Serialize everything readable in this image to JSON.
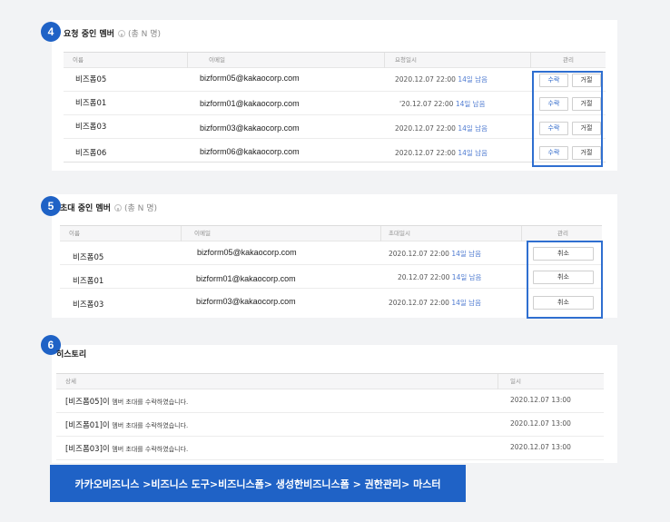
{
  "requested": {
    "badge": "4",
    "title": "요청 중인 멤버",
    "count": "(총 N 명)",
    "headers": {
      "name": "이름",
      "email": "이메일",
      "requested_at": "요청일시",
      "manage": "관리"
    },
    "rows": [
      {
        "name": "비즈폼05",
        "email": "bizform05@kakaocorp.com",
        "date": "2020.12.07 22:00",
        "remain": "14일 남음",
        "accept": "수락",
        "reject": "거절"
      },
      {
        "name": "비즈폼01",
        "email": "bizform01@kakaocorp.com",
        "date": "'20.12.07 22:00",
        "remain": "14일 남음",
        "accept": "수락",
        "reject": "거절"
      },
      {
        "name": "비즈폼03",
        "email": "bizform03@kakaocorp.com",
        "date": "2020.12.07 22:00",
        "remain": "14일 남음",
        "accept": "수락",
        "reject": "거절"
      },
      {
        "name": "비즈폼06",
        "email": "bizform06@kakaocorp.com",
        "date": "2020.12.07 22:00",
        "remain": "14일 남음",
        "accept": "수락",
        "reject": "거절"
      }
    ]
  },
  "invited": {
    "badge": "5",
    "title": "초대 중인 멤버",
    "count": "(총 N 명)",
    "headers": {
      "name": "이름",
      "email": "이메일",
      "invited_at": "초대일시",
      "manage": "관리"
    },
    "rows": [
      {
        "name": "비즈폼05",
        "email": "bizform05@kakaocorp.com",
        "date": "2020.12.07 22:00",
        "remain": "14일 남음",
        "cancel": "취소"
      },
      {
        "name": "비즈폼01",
        "email": "bizform01@kakaocorp.com",
        "date": "20.12.07 22:00",
        "remain": "14일 남음",
        "cancel": "취소"
      },
      {
        "name": "비즈폼03",
        "email": "bizform03@kakaocorp.com",
        "date": "2020.12.07 22:00",
        "remain": "14일 남음",
        "cancel": "취소"
      }
    ]
  },
  "history": {
    "badge": "6",
    "title": "히스토리",
    "headers": {
      "detail": "상세",
      "datetime": "일시"
    },
    "rows": [
      {
        "tag": "[비즈폼05]이",
        "message": "멤버 초대를 수락하였습니다.",
        "date": "2020.12.07 13:00"
      },
      {
        "tag": "[비즈폼01]이",
        "message": "멤버 초대를 수락하였습니다.",
        "date": "2020.12.07 13:00"
      },
      {
        "tag": "[비즈폼03]이",
        "message": "멤버 초대를 수락하였습니다.",
        "date": "2020.12.07 13:00"
      }
    ]
  },
  "breadcrumb": "카카오비즈니스 >비즈니스 도구>비즈니스폼> 생성한비즈니스폼 > 권한관리> 마스터",
  "colors": {
    "accent": "#1f62c6",
    "highlight": "#2f6fd0",
    "remain_text": "#4f7bd1"
  }
}
